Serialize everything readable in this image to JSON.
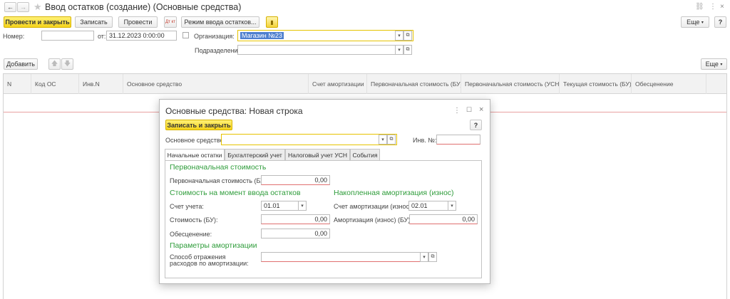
{
  "window": {
    "title": "Ввод остатков (создание) (Основные средства)"
  },
  "toolbar": {
    "post_close": "Провести и закрыть",
    "write": "Записать",
    "post": "Провести",
    "dtkt_icon_text": "Дт кт",
    "mode": "Режим ввода остатков...",
    "more": "Еще",
    "help": "?"
  },
  "header": {
    "number_label": "Номер:",
    "number_value": "",
    "date_label": "от:",
    "date_value": "31.12.2023  0:00:00",
    "org_label": "Организация:",
    "org_value": "Магазин №23",
    "division_label": "Подразделение:",
    "division_value": ""
  },
  "table_toolbar": {
    "add": "Добавить",
    "more": "Еще"
  },
  "table": {
    "columns": [
      "N",
      "Код ОС",
      "Инв.N",
      "Основное средство",
      "Счет амортизации",
      "Первоначальная стоимость (БУ)",
      "Первоначальная стоимость (УСН)",
      "Текущая стоимость (БУ)",
      "Обесценение"
    ]
  },
  "dialog": {
    "title": "Основные средства: Новая строка",
    "write_close": "Записать и закрыть",
    "help": "?",
    "asset_label": "Основное средство:",
    "asset_value": "",
    "inv_label": "Инв. №:",
    "inv_value": "",
    "tabs": [
      "Начальные остатки",
      "Бухгалтерский учет",
      "Налоговый учет УСН",
      "События"
    ],
    "initial_cost_section": "Первоначальная стоимость",
    "initial_cost_label": "Первоначальная стоимость (БУ):",
    "initial_cost_value": "0,00",
    "cost_at_entry_section": "Стоимость на момент ввода остатков",
    "account_label": "Счет учета:",
    "account_value": "01.01",
    "cost_label": "Стоимость (БУ):",
    "cost_value": "0,00",
    "impairment_label": "Обесценение:",
    "impairment_value": "0,00",
    "accum_section": "Накопленная амортизация (износ)",
    "amort_account_label": "Счет амортизации (износа):",
    "amort_account_value": "02.01",
    "amort_label": "Амортизация (износ) (БУ):",
    "amort_value": "0,00",
    "amort_params_section": "Параметры амортизации",
    "method_label_1": "Способ отражения",
    "method_label_2": "расходов по амортизации:",
    "method_value": ""
  }
}
